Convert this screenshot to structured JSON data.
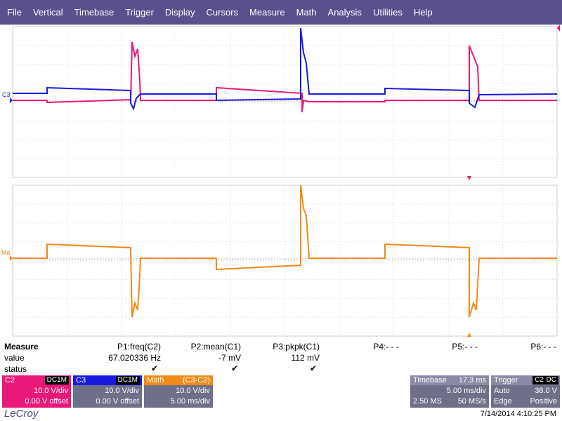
{
  "menu": [
    "File",
    "Vertical",
    "Timebase",
    "Trigger",
    "Display",
    "Cursors",
    "Measure",
    "Math",
    "Analysis",
    "Utilities",
    "Help"
  ],
  "colors": {
    "c2": "#e8197a",
    "c3": "#1a1adf",
    "math": "#f08a18",
    "menubar": "#5b4f8e",
    "panel": "#6f6f8a"
  },
  "markers": {
    "c3": "C3",
    "ma": "Ma"
  },
  "measure": {
    "title": "Measure",
    "row_labels": [
      "value",
      "status"
    ],
    "params": [
      {
        "name": "P1:freq(C2)",
        "value": "67.020336 Hz",
        "status": "✔"
      },
      {
        "name": "P2:mean(C1)",
        "value": "-7 mV",
        "status": "✔"
      },
      {
        "name": "P3:pkpk(C1)",
        "value": "112 mV",
        "status": "✔"
      },
      {
        "name": "P4:- - -",
        "value": "",
        "status": ""
      },
      {
        "name": "P5:- - -",
        "value": "",
        "status": ""
      },
      {
        "name": "P6:- - -",
        "value": "",
        "status": ""
      }
    ]
  },
  "channels": [
    {
      "id": "C2",
      "coupling": "DC1M",
      "vdiv": "10.0 V/div",
      "offset": "0.00 V offset"
    },
    {
      "id": "C3",
      "coupling": "DC1M",
      "vdiv": "10.0 V/div",
      "offset": "0.00 V offset"
    },
    {
      "id": "Math",
      "formula": "(C3-C2)",
      "vdiv": "10.0 V/div",
      "tdiv": "5.00 ms/div"
    }
  ],
  "timebase": {
    "label": "Timebase",
    "delay": "17.3 ms",
    "tdiv": "5.00 ms/div",
    "samples": "2.50 MS",
    "rate": "50 MS/s"
  },
  "trigger": {
    "label": "Trigger",
    "source": "C2",
    "coupling": "DC",
    "mode": "Auto",
    "level": "38.0 V",
    "type": "Edge",
    "slope": "Positive"
  },
  "brand": "LeCroy",
  "datetime": "7/14/2014 4:10:25 PM"
}
